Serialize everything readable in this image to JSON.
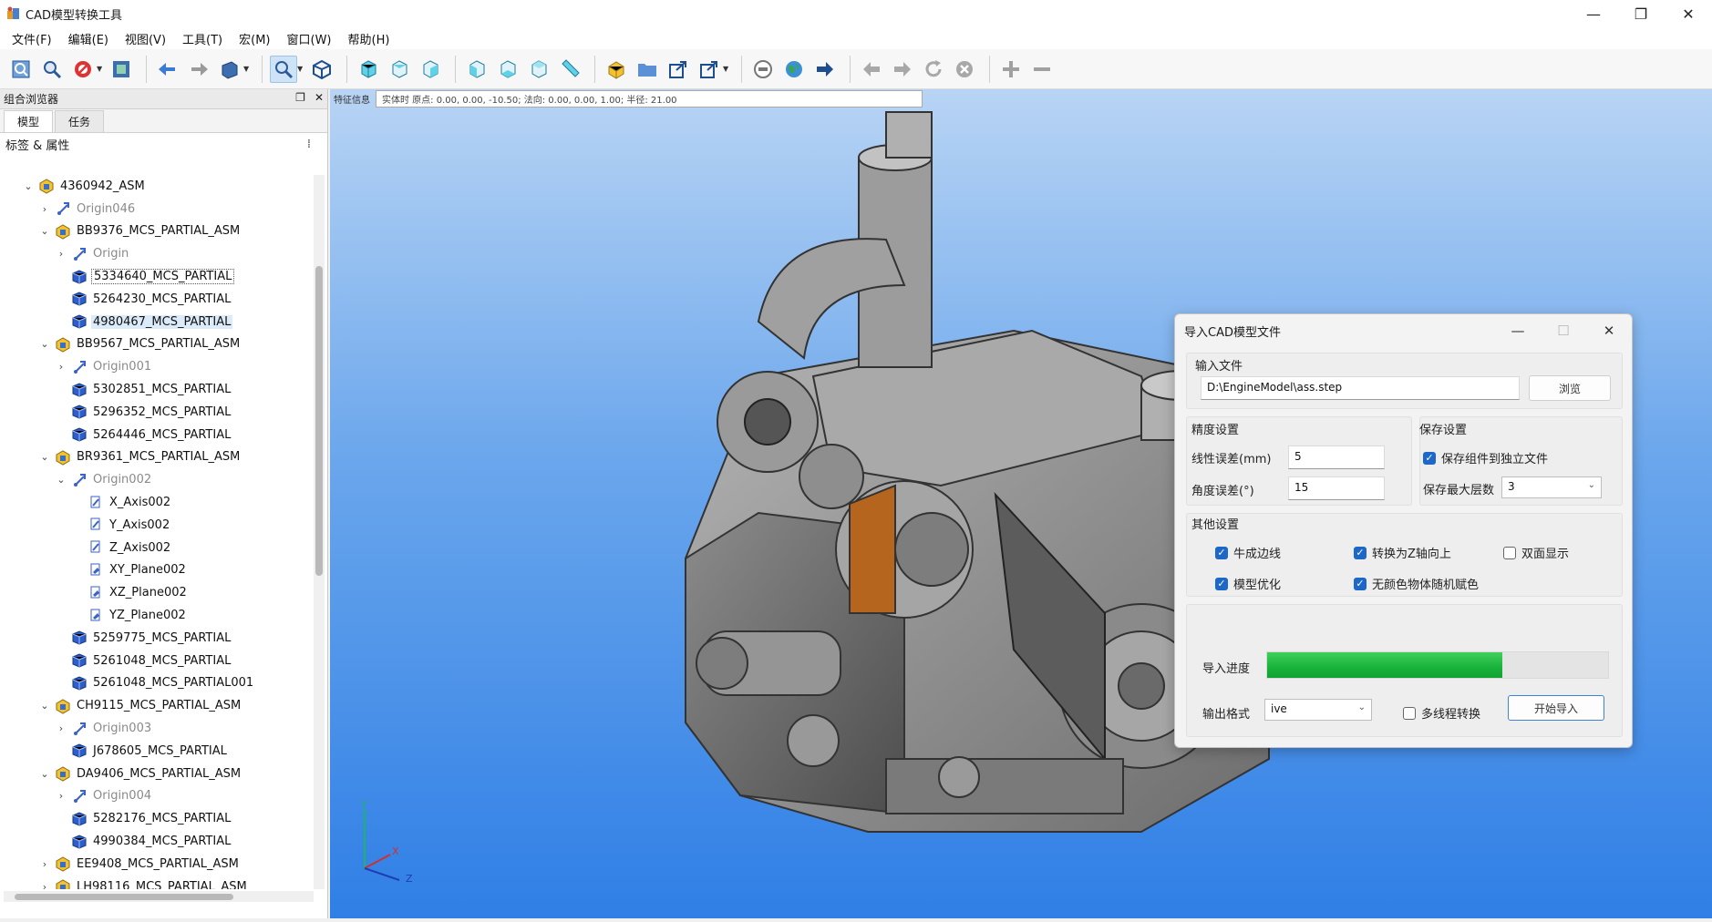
{
  "window": {
    "title": "CAD模型转换工具",
    "controls": [
      "—",
      "❐",
      "✕"
    ]
  },
  "menu": [
    "文件(F)",
    "编辑(E)",
    "视图(V)",
    "工具(T)",
    "宏(M)",
    "窗口(W)",
    "帮助(H)"
  ],
  "toolbar": {
    "icons": [
      "select-icon",
      "zoom-region-icon",
      "stop-icon",
      "box-select-icon",
      "back-arrow-icon",
      "forward-arrow-icon",
      "view-cube-icon",
      "zoom-fit-icon",
      "isometric-icon",
      "front-view-icon",
      "top-view-icon",
      "right-view-icon",
      "rear-view-icon",
      "bottom-view-icon",
      "left-view-icon",
      "measure-icon",
      "part-icon",
      "folder-icon",
      "export-icon",
      "export-dropdown-icon",
      "stop-circle-icon",
      "globe-icon",
      "navigate-forward-icon",
      "history-back-icon",
      "history-forward-icon",
      "refresh-icon",
      "cancel-icon",
      "zoom-in-icon",
      "zoom-out-icon"
    ]
  },
  "left_panel": {
    "title": "组合浏览器",
    "tabs": [
      "模型",
      "任务"
    ],
    "tree_header": "标签 & 属性",
    "tree": [
      {
        "level": 0,
        "expander": "v",
        "icon": "assembly",
        "label": "4360942_ASM",
        "muted": false
      },
      {
        "level": 1,
        "expander": ">",
        "icon": "origin",
        "label": "Origin046",
        "muted": true
      },
      {
        "level": 1,
        "expander": "v",
        "icon": "assembly",
        "label": "BB9376_MCS_PARTIAL_ASM",
        "muted": false
      },
      {
        "level": 2,
        "expander": ">",
        "icon": "origin",
        "label": "Origin",
        "muted": true
      },
      {
        "level": 2,
        "expander": "",
        "icon": "part",
        "label": "5334640_MCS_PARTIAL",
        "muted": false,
        "focused": true
      },
      {
        "level": 2,
        "expander": "",
        "icon": "part",
        "label": "5264230_MCS_PARTIAL",
        "muted": false
      },
      {
        "level": 2,
        "expander": "",
        "icon": "part",
        "label": "4980467_MCS_PARTIAL",
        "muted": false,
        "selected": true
      },
      {
        "level": 1,
        "expander": "v",
        "icon": "assembly",
        "label": "BB9567_MCS_PARTIAL_ASM",
        "muted": false
      },
      {
        "level": 2,
        "expander": ">",
        "icon": "origin",
        "label": "Origin001",
        "muted": true
      },
      {
        "level": 2,
        "expander": "",
        "icon": "part",
        "label": "5302851_MCS_PARTIAL",
        "muted": false
      },
      {
        "level": 2,
        "expander": "",
        "icon": "part",
        "label": "5296352_MCS_PARTIAL",
        "muted": false
      },
      {
        "level": 2,
        "expander": "",
        "icon": "part",
        "label": "5264446_MCS_PARTIAL",
        "muted": false
      },
      {
        "level": 1,
        "expander": "v",
        "icon": "assembly",
        "label": "BR9361_MCS_PARTIAL_ASM",
        "muted": false
      },
      {
        "level": 2,
        "expander": "v",
        "icon": "origin",
        "label": "Origin002",
        "muted": true
      },
      {
        "level": 3,
        "expander": "",
        "icon": "axis",
        "label": "X_Axis002",
        "muted": false
      },
      {
        "level": 3,
        "expander": "",
        "icon": "axis",
        "label": "Y_Axis002",
        "muted": false
      },
      {
        "level": 3,
        "expander": "",
        "icon": "axis",
        "label": "Z_Axis002",
        "muted": false
      },
      {
        "level": 3,
        "expander": "",
        "icon": "plane",
        "label": "XY_Plane002",
        "muted": false
      },
      {
        "level": 3,
        "expander": "",
        "icon": "plane",
        "label": "XZ_Plane002",
        "muted": false
      },
      {
        "level": 3,
        "expander": "",
        "icon": "plane",
        "label": "YZ_Plane002",
        "muted": false
      },
      {
        "level": 2,
        "expander": "",
        "icon": "part",
        "label": "5259775_MCS_PARTIAL",
        "muted": false
      },
      {
        "level": 2,
        "expander": "",
        "icon": "part",
        "label": "5261048_MCS_PARTIAL",
        "muted": false
      },
      {
        "level": 2,
        "expander": "",
        "icon": "part",
        "label": "5261048_MCS_PARTIAL001",
        "muted": false
      },
      {
        "level": 1,
        "expander": "v",
        "icon": "assembly",
        "label": "CH9115_MCS_PARTIAL_ASM",
        "muted": false
      },
      {
        "level": 2,
        "expander": ">",
        "icon": "origin",
        "label": "Origin003",
        "muted": true
      },
      {
        "level": 2,
        "expander": "",
        "icon": "part",
        "label": "J678605_MCS_PARTIAL",
        "muted": false
      },
      {
        "level": 1,
        "expander": "v",
        "icon": "assembly",
        "label": "DA9406_MCS_PARTIAL_ASM",
        "muted": false
      },
      {
        "level": 2,
        "expander": ">",
        "icon": "origin",
        "label": "Origin004",
        "muted": true
      },
      {
        "level": 2,
        "expander": "",
        "icon": "part",
        "label": "5282176_MCS_PARTIAL",
        "muted": false
      },
      {
        "level": 2,
        "expander": "",
        "icon": "part",
        "label": "4990384_MCS_PARTIAL",
        "muted": false
      },
      {
        "level": 1,
        "expander": ">",
        "icon": "assembly",
        "label": "EE9408_MCS_PARTIAL_ASM",
        "muted": false
      },
      {
        "level": 1,
        "expander": ">",
        "icon": "assembly",
        "label": "LH98116_MCS_PARTIAL_ASM",
        "muted": false
      }
    ]
  },
  "viewport": {
    "info_label": "特征信息",
    "info_text": "实体时  原点: 0.00, 0.00, -10.50; 法向: 0.00, 0.00, 1.00; 半径: 21.00",
    "axis_labels": {
      "x": "X",
      "y": "Y",
      "z": "Z"
    }
  },
  "dialog": {
    "title": "导入CAD模型文件",
    "input_group_label": "输入文件",
    "input_path": "D:\\EngineModel\\ass.step",
    "browse_label": "浏览",
    "precision_group_label": "精度设置",
    "linear_label": "线性误差(mm)",
    "linear_value": "5",
    "angular_label": "角度误差(°)",
    "angular_value": "15",
    "save_group_label": "保存设置",
    "save_separate_label": "保存组件到独立文件",
    "save_separate_checked": true,
    "max_levels_label": "保存最大层数",
    "max_levels_value": "3",
    "other_group_label": "其他设置",
    "opt_sew": "牛成边线",
    "opt_sew_checked": true,
    "opt_zup": "转换为Z轴向上",
    "opt_zup_checked": true,
    "opt_double": "双面显示",
    "opt_double_checked": false,
    "opt_optimize": "模型优化",
    "opt_optimize_checked": true,
    "opt_random_color": "无颜色物体随机赋色",
    "opt_random_color_checked": true,
    "progress_label": "导入进度",
    "progress_value": 0.69,
    "format_label": "输出格式",
    "format_value": "ive",
    "multithread_label": "多线程转换",
    "multithread_checked": false,
    "start_label": "开始导入"
  },
  "colors": {
    "accent": "#1d67c9",
    "progress": "#18b23a",
    "viewport_top": "#b8d4f4",
    "viewport_bottom": "#2f7fe6"
  }
}
